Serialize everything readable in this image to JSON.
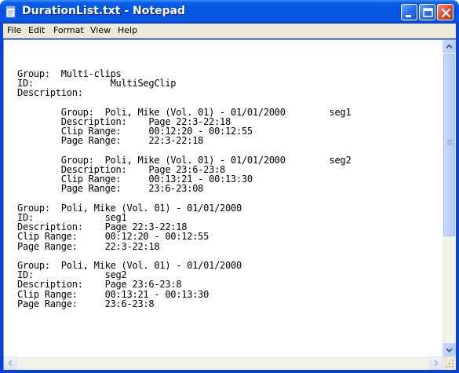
{
  "window": {
    "title": "DurationList.txt - Notepad"
  },
  "menu": {
    "file": "File",
    "edit": "Edit",
    "format": "Format",
    "view": "View",
    "help": "Help"
  },
  "document": {
    "text": "Group:  Multi-clips\nID:              MultiSegClip\nDescription:\n\n        Group:  Poli, Mike (Vol. 01) - 01/01/2000        seg1\n        Description:    Page 22:3-22:18\n        Clip Range:     00:12:20 - 00:12:55\n        Page Range:     22:3-22:18\n\n        Group:  Poli, Mike (Vol. 01) - 01/01/2000        seg2\n        Description:    Page 23:6-23:8\n        Clip Range:     00:13:21 - 00:13:30\n        Page Range:     23:6-23:08\n\nGroup:  Poli, Mike (Vol. 01) - 01/01/2000\nID:             seg1\nDescription:    Page 22:3-22:18\nClip Range:     00:12:20 - 00:12:55\nPage Range:     22:3-22:18\n\nGroup:  Poli, Mike (Vol. 01) - 01/01/2000\nID:             seg2\nDescription:    Page 23:6-23:8\nClip Range:     00:13:21 - 00:13:30\nPage Range:     23:6-23:8"
  },
  "colors": {
    "titlebar": "#0452e0",
    "menubar": "#ece9d8",
    "close_button": "#d9482a"
  },
  "icons": {
    "app": "notepad-icon",
    "minimize": "minimize-icon",
    "maximize": "maximize-icon",
    "close": "close-icon"
  }
}
